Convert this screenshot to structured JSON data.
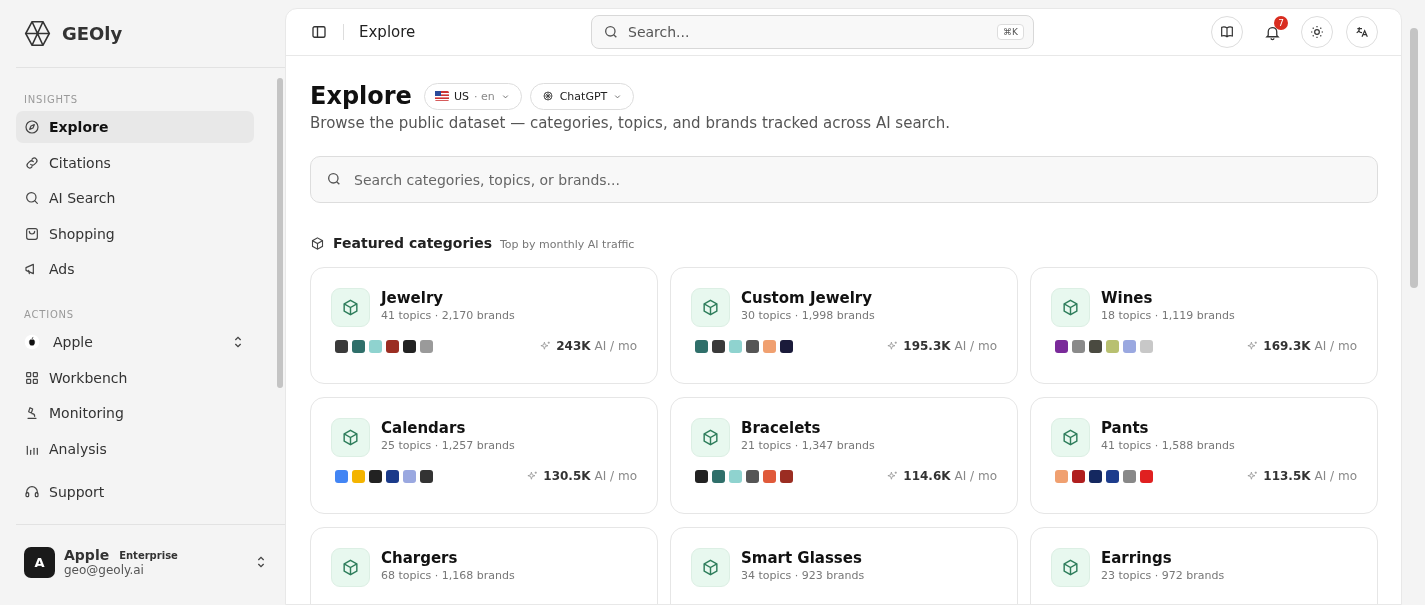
{
  "sidebar": {
    "logo": "GEOly",
    "sections": [
      {
        "title": "INSIGHTS",
        "items": [
          {
            "kind": "link",
            "label": "Explore",
            "selected": true
          },
          {
            "kind": "link",
            "label": "Citations",
            "selected": false
          },
          {
            "kind": "link",
            "label": "AI Search",
            "selected": false
          },
          {
            "kind": "link",
            "label": "Shopping",
            "selected": false
          },
          {
            "kind": "link",
            "label": "Ads",
            "selected": false
          }
        ]
      },
      {
        "title": "ACTIONS",
        "items": [
          {
            "kind": "switcher",
            "label": "Apple",
            "selected": false
          },
          {
            "kind": "link",
            "label": "Workbench",
            "selected": false
          },
          {
            "kind": "link",
            "label": "Monitoring",
            "selected": false
          },
          {
            "kind": "link",
            "label": "Analysis",
            "selected": false
          }
        ]
      }
    ],
    "support": "Support",
    "account": {
      "avatar": "A",
      "name": "Apple",
      "plan": "Enterprise",
      "email": "geo@geoly.ai"
    }
  },
  "topbar": {
    "breadcrumb": "Explore",
    "search": {
      "placeholder": "Search...",
      "shortcut": "⌘K"
    },
    "notifications": "7"
  },
  "header": {
    "title": "Explore",
    "region": "US",
    "language": "· en",
    "model": "ChatGPT",
    "subtitle": "Browse the public dataset — categories, topics, and brands tracked across AI search."
  },
  "search": {
    "placeholder": "Search categories, topics, or brands..."
  },
  "featured": {
    "title": "Featured categories",
    "subtitle": "Top by monthly AI traffic",
    "cards": [
      {
        "name": "Jewelry",
        "stats": "41 topics · 2,170 brands",
        "traffic": "243K",
        "unit": "AI / mo",
        "logos": [
          {
            "color": "#3a3a3a"
          },
          {
            "color": "#2f6f6a"
          },
          {
            "color": "#8fd3cf"
          },
          {
            "color": "#9b2d22"
          },
          {
            "color": "#222222"
          },
          {
            "color": "#9a9a9a"
          }
        ]
      },
      {
        "name": "Custom Jewelry",
        "stats": "30 topics · 1,998 brands",
        "traffic": "195.3K",
        "unit": "AI / mo",
        "logos": [
          {
            "color": "#2f6f6a"
          },
          {
            "color": "#3a3a3a"
          },
          {
            "color": "#8fd3cf"
          },
          {
            "color": "#555555"
          },
          {
            "color": "#f0a070"
          },
          {
            "color": "#1a1a3a"
          }
        ]
      },
      {
        "name": "Wines",
        "stats": "18 topics · 1,119 brands",
        "traffic": "169.3K",
        "unit": "AI / mo",
        "logos": [
          {
            "color": "#7a2a9a"
          },
          {
            "color": "#8a8a8a"
          },
          {
            "color": "#4a4a40"
          },
          {
            "color": "#b8c070"
          },
          {
            "color": "#9aa8e0"
          },
          {
            "color": "#c8c8c8"
          }
        ]
      },
      {
        "name": "Calendars",
        "stats": "25 topics · 1,257 brands",
        "traffic": "130.5K",
        "unit": "AI / mo",
        "logos": [
          {
            "color": "#4285f4"
          },
          {
            "color": "#f4b400"
          },
          {
            "color": "#222222"
          },
          {
            "color": "#1a3a8a"
          },
          {
            "color": "#9aa8e0"
          },
          {
            "color": "#333333"
          }
        ]
      },
      {
        "name": "Bracelets",
        "stats": "21 topics · 1,347 brands",
        "traffic": "114.6K",
        "unit": "AI / mo",
        "logos": [
          {
            "color": "#222222"
          },
          {
            "color": "#2f6f6a"
          },
          {
            "color": "#8fd3cf"
          },
          {
            "color": "#555555"
          },
          {
            "color": "#e05a3a"
          },
          {
            "color": "#9b2d22"
          }
        ]
      },
      {
        "name": "Pants",
        "stats": "41 topics · 1,588 brands",
        "traffic": "113.5K",
        "unit": "AI / mo",
        "logos": [
          {
            "color": "#f0a070"
          },
          {
            "color": "#b01e1e"
          },
          {
            "color": "#142860"
          },
          {
            "color": "#1c3c8c"
          },
          {
            "color": "#888888"
          },
          {
            "color": "#e02020"
          }
        ]
      },
      {
        "name": "Chargers",
        "stats": "68 topics · 1,168 brands"
      },
      {
        "name": "Smart Glasses",
        "stats": "34 topics · 923 brands"
      },
      {
        "name": "Earrings",
        "stats": "23 topics · 972 brands"
      }
    ]
  }
}
